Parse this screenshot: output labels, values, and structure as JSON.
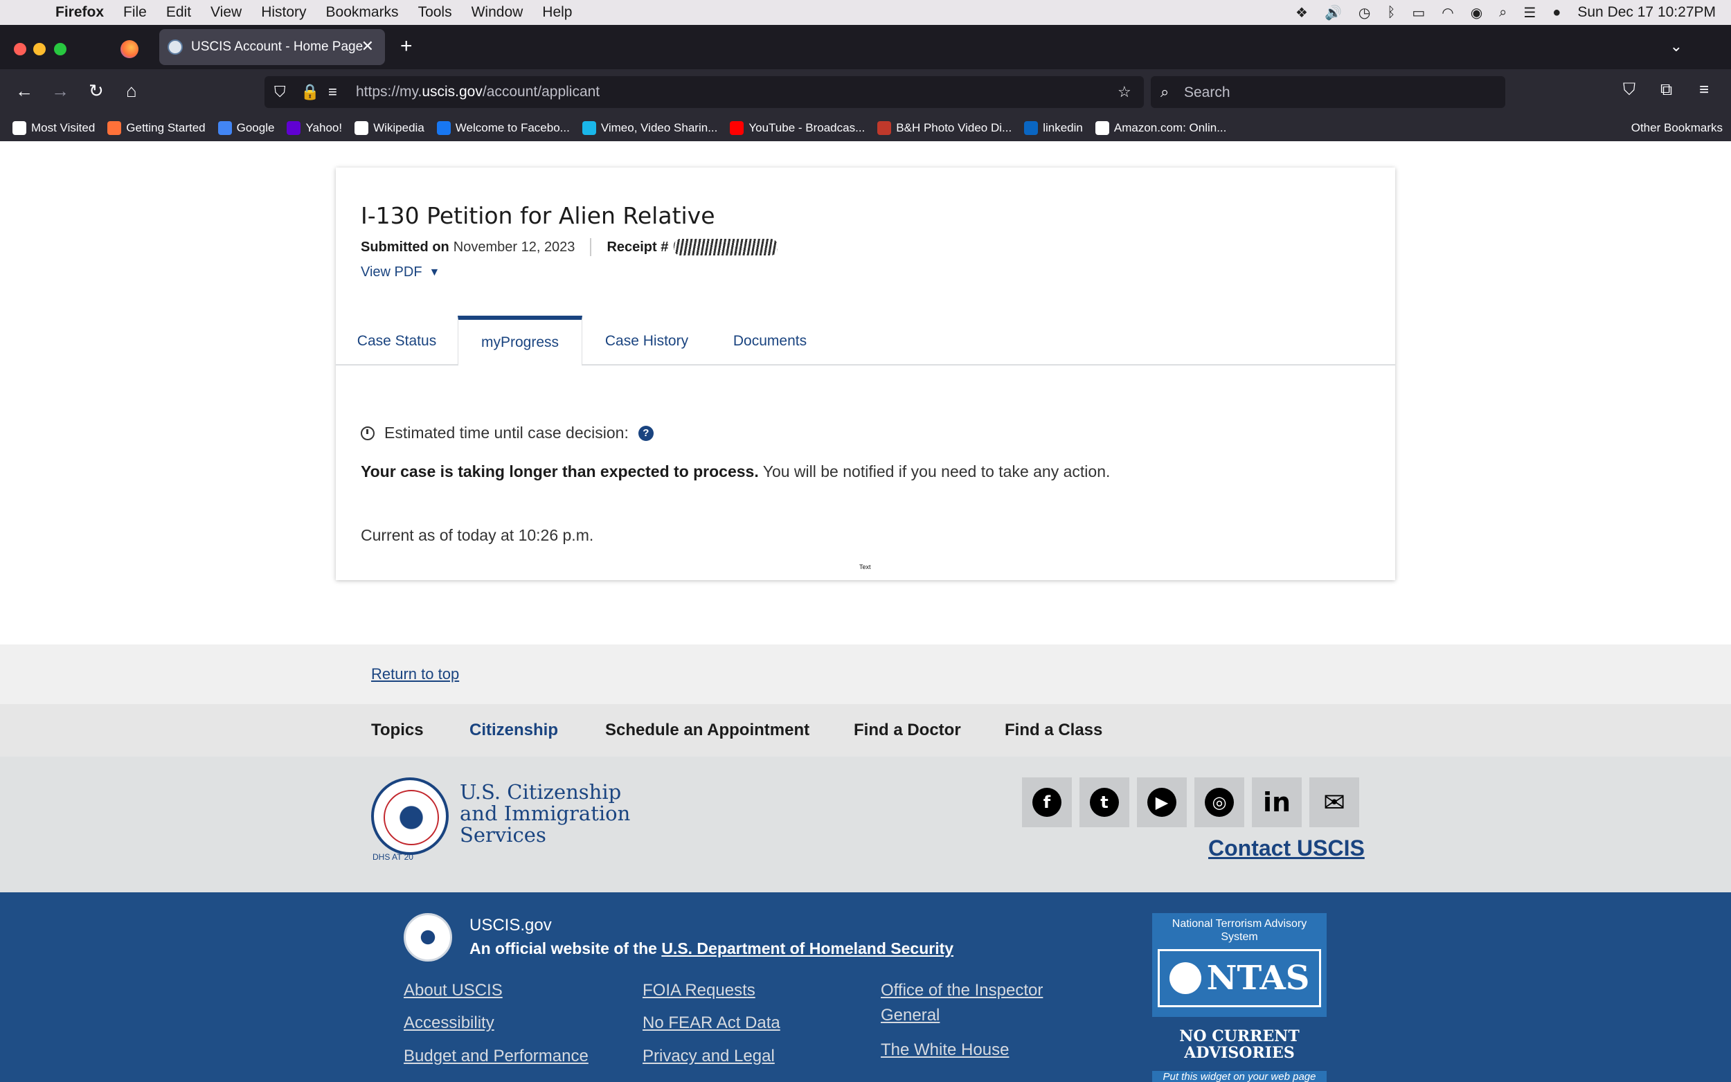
{
  "menubar": {
    "app": "Firefox",
    "items": [
      "File",
      "Edit",
      "View",
      "History",
      "Bookmarks",
      "Tools",
      "Window",
      "Help"
    ],
    "datetime": "Sun Dec 17  10:27PM"
  },
  "browser": {
    "tab_title": "USCIS Account - Home Page",
    "url_prefix": "https://my.",
    "url_domain": "uscis.gov",
    "url_path": "/account/applicant",
    "search_placeholder": "Search",
    "bookmarks": [
      {
        "label": "Most Visited",
        "icon": "gear-icon",
        "color": "#ffffff"
      },
      {
        "label": "Getting Started",
        "icon": "firefox-icon",
        "color": "#ff7139"
      },
      {
        "label": "Google",
        "icon": "google-icon",
        "color": "#4285f4"
      },
      {
        "label": "Yahoo!",
        "icon": "yahoo-icon",
        "color": "#6001d2"
      },
      {
        "label": "Wikipedia",
        "icon": "wikipedia-icon",
        "color": "#ffffff"
      },
      {
        "label": "Welcome to Facebo...",
        "icon": "facebook-icon",
        "color": "#1877f2"
      },
      {
        "label": "Vimeo, Video Sharin...",
        "icon": "vimeo-icon",
        "color": "#1ab7ea"
      },
      {
        "label": "YouTube - Broadcas...",
        "icon": "youtube-icon",
        "color": "#ff0000"
      },
      {
        "label": "B&H Photo Video Di...",
        "icon": "bh-icon",
        "color": "#c0392b"
      },
      {
        "label": "linkedin",
        "icon": "linkedin-icon",
        "color": "#0a66c2"
      },
      {
        "label": "Amazon.com: Onlin...",
        "icon": "amazon-icon",
        "color": "#ffffff"
      }
    ],
    "other_bookmarks": "Other Bookmarks"
  },
  "case": {
    "title": "I-130 Petition for Alien Relative",
    "submitted_label": "Submitted on",
    "submitted_date": "November 12, 2023",
    "receipt_label": "Receipt #",
    "view_pdf": "View PDF",
    "tabs": [
      "Case Status",
      "myProgress",
      "Case History",
      "Documents"
    ],
    "active_tab": "myProgress",
    "estimate_label": "Estimated time until case decision:",
    "delay_bold": "Your case is taking longer than expected to process.",
    "delay_rest": " You will be notified if you need to take any action.",
    "current_as_of": "Current as of today at 10:26 p.m.",
    "tiny_text": "Text"
  },
  "footer": {
    "return_to_top": "Return to top",
    "nav": [
      "Topics",
      "Citizenship",
      "Schedule an Appointment",
      "Find a Doctor",
      "Find a Class"
    ],
    "agency_name": "U.S. Citizenship and Immigration Services",
    "seal_caption": "DHS AT 20",
    "social": [
      "facebook-icon",
      "twitter-icon",
      "youtube-icon",
      "instagram-icon",
      "linkedin-icon",
      "email-icon"
    ],
    "contact": "Contact USCIS",
    "site_name": "USCIS.gov",
    "official_prefix": "An official website of the ",
    "official_link": "U.S. Department of Homeland Security",
    "links_col1": [
      "About USCIS",
      "Accessibility",
      "Budget and Performance"
    ],
    "links_col2": [
      "FOIA Requests",
      "No FEAR Act Data",
      "Privacy and Legal"
    ],
    "links_col3": [
      "Office of the Inspector General",
      "The White House"
    ],
    "ntas_heading": "National Terrorism Advisory System",
    "ntas_logo": "NTAS",
    "ntas_advisory": "NO CURRENT ADVISORIES",
    "ntas_widget": "Put this widget on your web page"
  },
  "colors": {
    "link_blue": "#1a4480",
    "footer_dark": "#1f4e86",
    "browser_dark": "#2b2a33"
  }
}
